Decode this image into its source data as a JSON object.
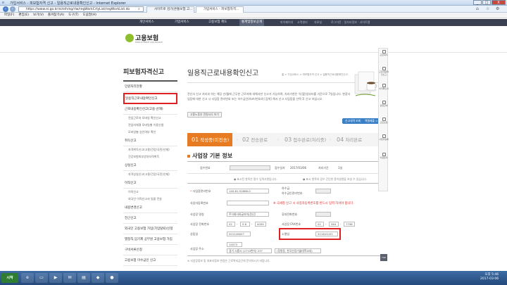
{
  "window": {
    "title": "가입서비스 - 피보험자격 신고 - 일용직근로내용확인신고 - Internet Explorer",
    "controls": [
      "_",
      "□",
      "X"
    ]
  },
  "browser": {
    "url": "https://www.ei.go.kr/ei/eih/eg/rlw/regWorkCrtyList/regWorkList.do",
    "tabs": [
      "사이트로 검기(온통보험 고...",
      "가입서비스 - 피보험자격..."
    ],
    "menu": [
      "파일(F)",
      "편집(E)",
      "보기(V)",
      "즐겨찾기(A)",
      "도구(T)",
      "도움말(H)"
    ]
  },
  "topnav": {
    "items": [
      "개인서비스",
      "기업서비스",
      "고용보험 제도",
      "통계및정보공개"
    ],
    "active": "통계및정보공개",
    "util": [
      "마이페이지",
      "고객센터",
      "자료실",
      "로그아웃 · 일자리정보 · 사이트맵"
    ]
  },
  "logo": {
    "name": "고용보험",
    "sub": "EMPLOYMENT INSURANCE"
  },
  "sidebar": {
    "title": "피보험자격신고",
    "items": [
      {
        "label": "민원처리현황",
        "level": 1
      },
      {
        "label": "일용직근로내용확인신고",
        "level": 1,
        "active": true
      },
      {
        "label": "근로내용확인신고(고용·산재)",
        "level": 1
      },
      {
        "label": "전업근로자 모바일 확인신고",
        "level": 2
      },
      {
        "label": "전업자체결 모바일별 이용신청",
        "level": 2
      },
      {
        "label": "모바일별 승인여부 확인",
        "level": 2
      },
      {
        "label": "취득신고",
        "level": 1
      },
      {
        "label": "자격취득신고(고용/건강/국민/산재)",
        "level": 2
      },
      {
        "label": "건강보험피부양자자격취득",
        "level": 2
      },
      {
        "label": "상실신고",
        "level": 1
      },
      {
        "label": "자격상실신고(고용/건강/국민/산재)",
        "level": 2
      },
      {
        "label": "이직신고",
        "level": 1
      },
      {
        "label": "이직신고",
        "level": 2
      },
      {
        "label": "외국인 이직신고서 일괄 전송",
        "level": 2
      },
      {
        "label": "내용변경신고",
        "level": 1
      },
      {
        "label": "전근신고",
        "level": 1
      },
      {
        "label": "외국인 고용보험 가입(가입탈퇴)신청",
        "level": 1
      },
      {
        "label": "별정직,임기제 공무원 고용보험 가입",
        "level": 1
      },
      {
        "label": "구비서류신청",
        "level": 1
      },
      {
        "label": "고용보험 미수금인 신고",
        "level": 1
      }
    ]
  },
  "content": {
    "title": "일용직근로내용확인신고",
    "breadcrumb": "홈 > 가입서비스 > 피보험자격 신고 > 일용직근로내용확인신고",
    "intro": "전신서 신고 처리과 하는 해당 년/월에 근무한 근로자에 대해서만 신고가 가능하며, 처리기한은 익(翌)일부터를 기준으로 7일입니다. 현장사업장에 대한 신고 시 사업장 관리번호 또는 하수급인(Anh)번호와 [검색] 해서 신고 사업장을 선택 후 신고 하십시오.",
    "buttons": {
      "guide": "고용노동부 민원서식 보기",
      "history": "신고내역 조회 >",
      "excel": "엑셀제출 >"
    },
    "steps": [
      {
        "num": "01",
        "label": "작성중(미전송)"
      },
      {
        "num": "02",
        "label": "전송완료"
      },
      {
        "num": "03",
        "label": "접수완료(처리중)"
      },
      {
        "num": "04",
        "label": "처리완료"
      }
    ],
    "section": "사업장 기본 정보",
    "row1": {
      "recv_no_label": "접수번호",
      "recv_date_label": "접수일자",
      "recv_date": "2017/03/06",
      "proc_label": "처리기간",
      "proc_value": "1일"
    },
    "note1": "● 표시된 항목은 필수 입력사항입니다.",
    "note2": "● 표시 항목의 경우 간단한 용어설명을 보실 수 있습니다.",
    "fields": {
      "mgmt_no_label": "사업장관리번호",
      "mgmt_no": "140-81-52868-0",
      "sub_label": "하수급인관리번호",
      "sub_prefix": "하수급",
      "reg_no_label": "사업자등록번호",
      "red_warning": "※ 국세청 신고 시 사업자등록번호를 반드시 입력 하셔야 합니다.",
      "name_label": "사업장 명칭",
      "name": "주식회사와글러미(전)민",
      "phone_label": "사업장 전화번호",
      "phone": [
        "02",
        "-",
        "5·8",
        "-",
        "0009"
      ],
      "mobile_label": "휴대전화번호",
      "fax_label": "사업장 FAX번호",
      "fax": [
        "02",
        "-",
        "564",
        "-",
        "7796"
      ],
      "est_label": "성립일",
      "est": "2011/06/07",
      "end_label": "소멸일",
      "end": "2016/01/01",
      "addr_label": "사업장 주소",
      "zip": "15073",
      "addr1": "경기 시흥시 (2710번지) 237",
      "addr2": "(정왕동, 한국산업기술대학교내)"
    },
    "footnote": "※ 사업장정보 및 대표자정보 변경은 근로복지공단에 문의하시기 바랍니다."
  },
  "rightside": [
    "근로복지",
    "근로내용확인신고",
    "이직확인서",
    "실업급여",
    "근로보험",
    "사업자등록",
    "이용문의",
    "TOP"
  ],
  "taskbar": {
    "start": "시작",
    "clock_time": "오후 5:46",
    "clock_date": "2017-03-06"
  }
}
